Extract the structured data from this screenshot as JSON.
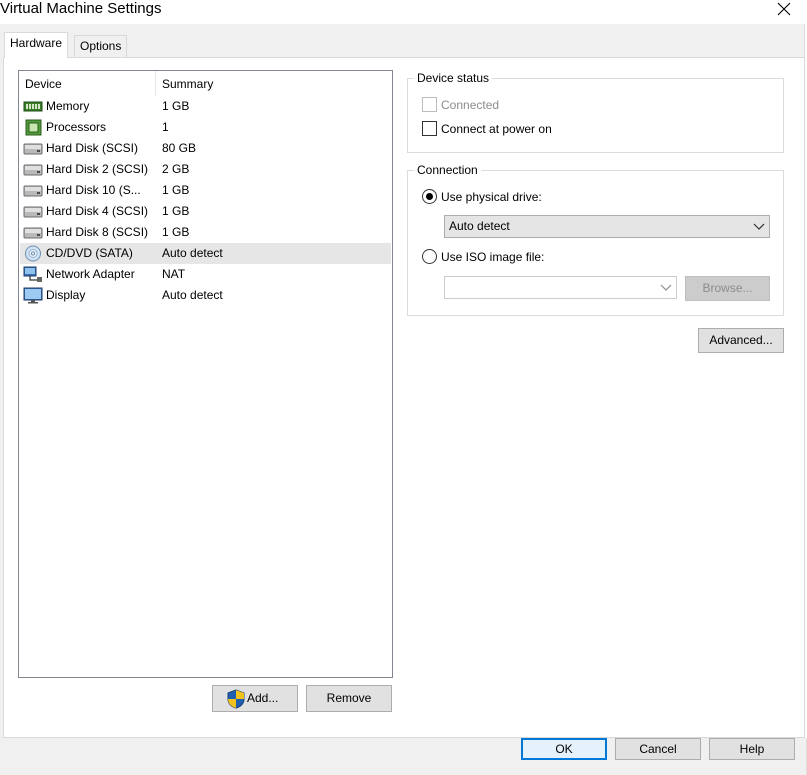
{
  "window": {
    "title": "Virtual Machine Settings",
    "close_icon": "close-icon"
  },
  "tabs": [
    {
      "label": "Hardware",
      "active": true
    },
    {
      "label": "Options",
      "active": false
    }
  ],
  "device_list": {
    "columns": [
      "Device",
      "Summary"
    ],
    "rows": [
      {
        "icon": "memory-icon",
        "device": "Memory",
        "summary": "1 GB"
      },
      {
        "icon": "processor-icon",
        "device": "Processors",
        "summary": "1"
      },
      {
        "icon": "hard-disk-icon",
        "device": "Hard Disk (SCSI)",
        "summary": "80 GB"
      },
      {
        "icon": "hard-disk-icon",
        "device": "Hard Disk 2 (SCSI)",
        "summary": "2 GB"
      },
      {
        "icon": "hard-disk-icon",
        "device": "Hard Disk 10 (S...",
        "summary": "1 GB"
      },
      {
        "icon": "hard-disk-icon",
        "device": "Hard Disk 4 (SCSI)",
        "summary": "1 GB"
      },
      {
        "icon": "hard-disk-icon",
        "device": "Hard Disk 8 (SCSI)",
        "summary": "1 GB"
      },
      {
        "icon": "cd-dvd-icon",
        "device": "CD/DVD (SATA)",
        "summary": "Auto detect",
        "selected": true
      },
      {
        "icon": "network-adapter-icon",
        "device": "Network Adapter",
        "summary": "NAT"
      },
      {
        "icon": "display-icon",
        "device": "Display",
        "summary": "Auto detect"
      }
    ],
    "add_label": "Add...",
    "remove_label": "Remove"
  },
  "device_status": {
    "title": "Device status",
    "connected_label": "Connected",
    "connected_checked": false,
    "connected_disabled": true,
    "power_on_label": "Connect at power on",
    "power_on_checked": false
  },
  "connection": {
    "title": "Connection",
    "physical_label": "Use physical drive:",
    "physical_selected": true,
    "physical_value": "Auto detect",
    "iso_label": "Use ISO image file:",
    "iso_selected": false,
    "iso_value": "",
    "browse_label": "Browse..."
  },
  "advanced_label": "Advanced...",
  "footer": {
    "ok_label": "OK",
    "cancel_label": "Cancel",
    "help_label": "Help"
  },
  "colors": {
    "accent": "#0078d7",
    "selection": "#e6e6e6",
    "dialog_bg": "#f0f0f0"
  }
}
